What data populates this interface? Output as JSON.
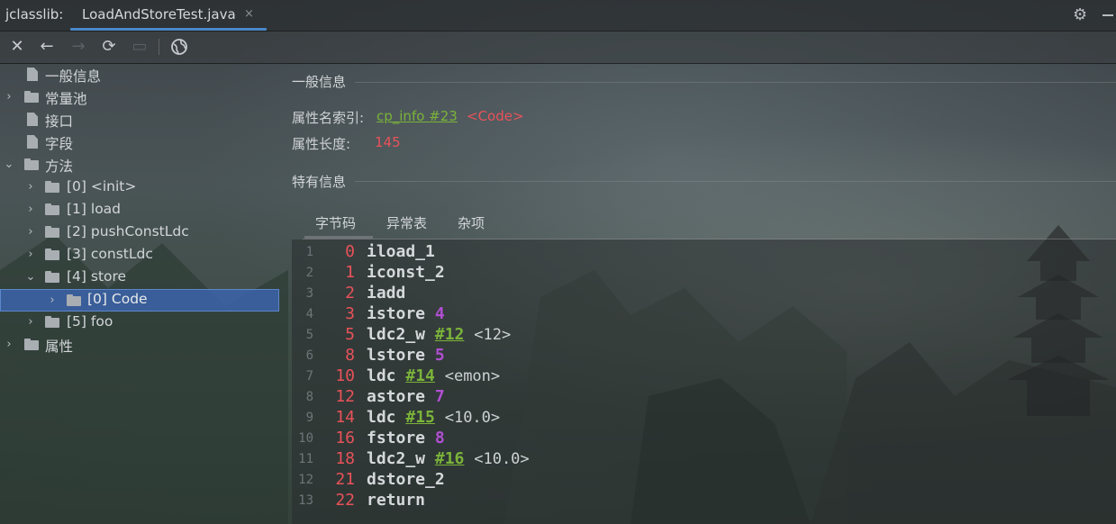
{
  "window": {
    "tool_title": "jclasslib:",
    "file_tab": "LoadAndStoreTest.java",
    "close_glyph": "×",
    "settings_icon": "gear-icon",
    "minimize_icon": "minimize-icon"
  },
  "toolbar": {
    "buttons": [
      "close-icon",
      "back-arrow-icon",
      "forward-arrow-icon",
      "refresh-icon",
      "browser-icon",
      "web-icon"
    ]
  },
  "tree": {
    "items": [
      {
        "label": "一般信息",
        "icon": "file-icon",
        "expanded": null
      },
      {
        "label": "常量池",
        "icon": "folder-icon",
        "expanded": false
      },
      {
        "label": "接口",
        "icon": "file-icon",
        "expanded": null
      },
      {
        "label": "字段",
        "icon": "file-icon",
        "expanded": null
      },
      {
        "label": "方法",
        "icon": "folder-icon",
        "expanded": true
      },
      {
        "label": "[0] <init>",
        "icon": "folder-icon",
        "expanded": false
      },
      {
        "label": "[1] load",
        "icon": "folder-icon",
        "expanded": false
      },
      {
        "label": "[2] pushConstLdc",
        "icon": "folder-icon",
        "expanded": false
      },
      {
        "label": "[3] constLdc",
        "icon": "folder-icon",
        "expanded": false
      },
      {
        "label": "[4] store",
        "icon": "folder-icon",
        "expanded": true
      },
      {
        "label": "[0] Code",
        "icon": "folder-icon",
        "expanded": false,
        "selected": true
      },
      {
        "label": "[5] foo",
        "icon": "folder-icon",
        "expanded": false
      },
      {
        "label": "属性",
        "icon": "folder-icon",
        "expanded": false
      }
    ]
  },
  "general": {
    "title": "一般信息",
    "attr_name_label": "属性名索引:",
    "attr_name_link": "cp_info #23",
    "attr_name_value": "<Code>",
    "attr_length_label": "属性长度:",
    "attr_length_value": "145"
  },
  "specific": {
    "title": "特有信息",
    "tabs": [
      "字节码",
      "异常表",
      "杂项"
    ],
    "active_tab": "字节码"
  },
  "bytecode": [
    {
      "line": "1",
      "offset": "0",
      "op": "iload_1",
      "arg": "",
      "cref": "",
      "comment": ""
    },
    {
      "line": "2",
      "offset": "1",
      "op": "iconst_2",
      "arg": "",
      "cref": "",
      "comment": ""
    },
    {
      "line": "3",
      "offset": "2",
      "op": "iadd",
      "arg": "",
      "cref": "",
      "comment": ""
    },
    {
      "line": "4",
      "offset": "3",
      "op": "istore",
      "arg": "4",
      "cref": "",
      "comment": ""
    },
    {
      "line": "5",
      "offset": "5",
      "op": "ldc2_w",
      "arg": "",
      "cref": "#12",
      "comment": "<12>"
    },
    {
      "line": "6",
      "offset": "8",
      "op": "lstore",
      "arg": "5",
      "cref": "",
      "comment": ""
    },
    {
      "line": "7",
      "offset": "10",
      "op": "ldc",
      "arg": "",
      "cref": "#14",
      "comment": "<emon>"
    },
    {
      "line": "8",
      "offset": "12",
      "op": "astore",
      "arg": "7",
      "cref": "",
      "comment": ""
    },
    {
      "line": "9",
      "offset": "14",
      "op": "ldc",
      "arg": "",
      "cref": "#15",
      "comment": "<10.0>"
    },
    {
      "line": "10",
      "offset": "16",
      "op": "fstore",
      "arg": "8",
      "cref": "",
      "comment": ""
    },
    {
      "line": "11",
      "offset": "18",
      "op": "ldc2_w",
      "arg": "",
      "cref": "#16",
      "comment": "<10.0>"
    },
    {
      "line": "12",
      "offset": "21",
      "op": "dstore_2",
      "arg": "",
      "cref": "",
      "comment": ""
    },
    {
      "line": "13",
      "offset": "22",
      "op": "return",
      "arg": "",
      "cref": "",
      "comment": ""
    }
  ],
  "colors": {
    "accent": "#4a88c7",
    "selection": "#3c64aa",
    "offset": "#e8525a",
    "link": "#7bb33a",
    "operand": "#b04fd1"
  }
}
